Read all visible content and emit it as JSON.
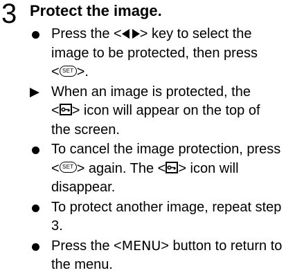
{
  "step": {
    "number": "3",
    "title": "Protect the image."
  },
  "items": [
    {
      "marker": "bullet",
      "l1_pre": "Press the <",
      "l1_icon": "left-right-arrows-icon",
      "l1_post": "> key to select the",
      "l2": "image to be protected, then press",
      "l3_pre": "<",
      "l3_icon_label": "SET",
      "l3_post": ">."
    },
    {
      "marker": "arrow",
      "l1": "When an image is protected, the",
      "l2_pre": "<",
      "l2_icon": "protect-key-icon",
      "l2_post": "> icon will appear on the top of",
      "l3": "the screen."
    },
    {
      "marker": "bullet",
      "l1": "To cancel the image protection, press",
      "l2_pre": "<",
      "l2_icon_label": "SET",
      "l2_mid": "> again. The <",
      "l2_icon2": "protect-key-icon",
      "l2_post": "> icon will",
      "l3": "disappear."
    },
    {
      "marker": "bullet",
      "l1": "To protect another image, repeat step",
      "l2": "3."
    },
    {
      "marker": "bullet",
      "l1_pre": "Press the <",
      "l1_menu": "MENU",
      "l1_post": "> button to return to",
      "l2": "the menu."
    }
  ]
}
